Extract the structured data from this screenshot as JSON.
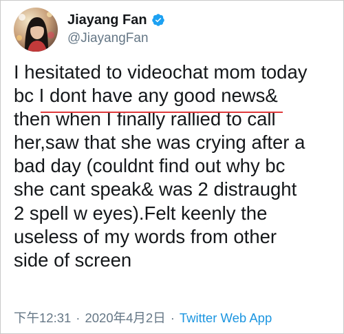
{
  "user": {
    "display_name": "Jiayang Fan",
    "handle": "@JiayangFan",
    "verified": true,
    "avatar_icon": "profile-photo"
  },
  "tweet": {
    "text": "I hesitated to videochat mom today\nbc I dont have any good news&\nthen when I finally rallied to call\nher,saw that she was crying after a\nbad day (couldnt find out why bc\nshe cant speak& was 2 distraught\n2 spell w eyes).Felt keenly the\nuseless of my words from other\nside of screen",
    "highlight_phrase": "I dont have any good news",
    "highlight_color": "#e0393b"
  },
  "footer": {
    "time": "下午12:31",
    "separator": "·",
    "date": "2020年4月2日",
    "app": "Twitter Web App"
  },
  "colors": {
    "text": "#14171a",
    "secondary": "#657786",
    "link": "#1b95e0",
    "verified_badge": "#1da1f2"
  }
}
